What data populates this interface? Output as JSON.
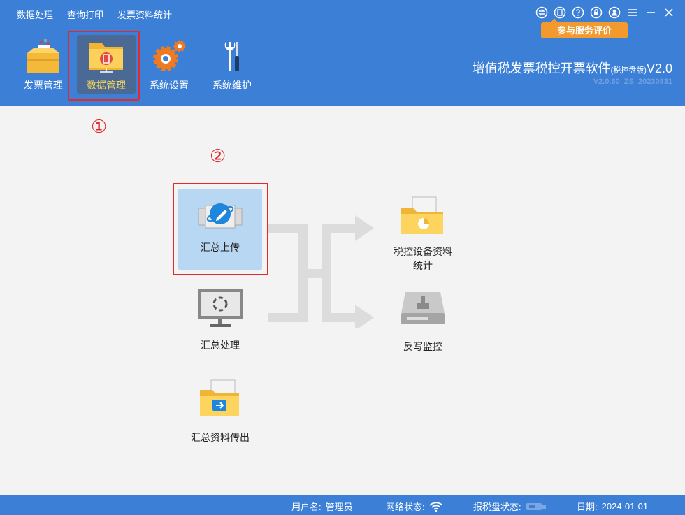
{
  "top_menu": [
    "数据处理",
    "查询打印",
    "发票资料统计"
  ],
  "window_controls": {
    "icons": [
      "exchange-icon",
      "pdf-icon",
      "help-icon",
      "lock-icon",
      "user-icon",
      "menu-icon",
      "minimize-icon",
      "close-icon"
    ]
  },
  "feedback_button": "参与服务评价",
  "toolbar": {
    "items": [
      {
        "label": "发票管理",
        "icon": "invoice-box-icon"
      },
      {
        "label": "数据管理",
        "icon": "data-folder-icon",
        "active": true
      },
      {
        "label": "系统设置",
        "icon": "gear-icon"
      },
      {
        "label": "系统维护",
        "icon": "tools-icon"
      }
    ]
  },
  "app": {
    "title": "增值税发票税控开票软件",
    "edition": "(税控盘版)",
    "version_short": "V2.0",
    "build": "V2.0.60_ZS_20230831"
  },
  "annotations": {
    "step1": "①",
    "step2": "②"
  },
  "functions": {
    "upload": "汇总上传",
    "process": "汇总处理",
    "export": "汇总资料传出",
    "stats_line1": "税控设备资料",
    "stats_line2": "统计",
    "monitor": "反写监控"
  },
  "status": {
    "username_label": "用户名:",
    "username": "管理员",
    "network_label": "网络状态:",
    "disk_label": "报税盘状态:",
    "date_label": "日期:",
    "date": "2024-01-01"
  },
  "colors": {
    "header_bg": "#3b7fd6",
    "active_tab_bg": "#4a6a95",
    "active_label": "#f7d35a",
    "feedback_bg": "#f29a2e",
    "highlight_box": "#e52828",
    "selected_tile": "#b7d7f2"
  }
}
